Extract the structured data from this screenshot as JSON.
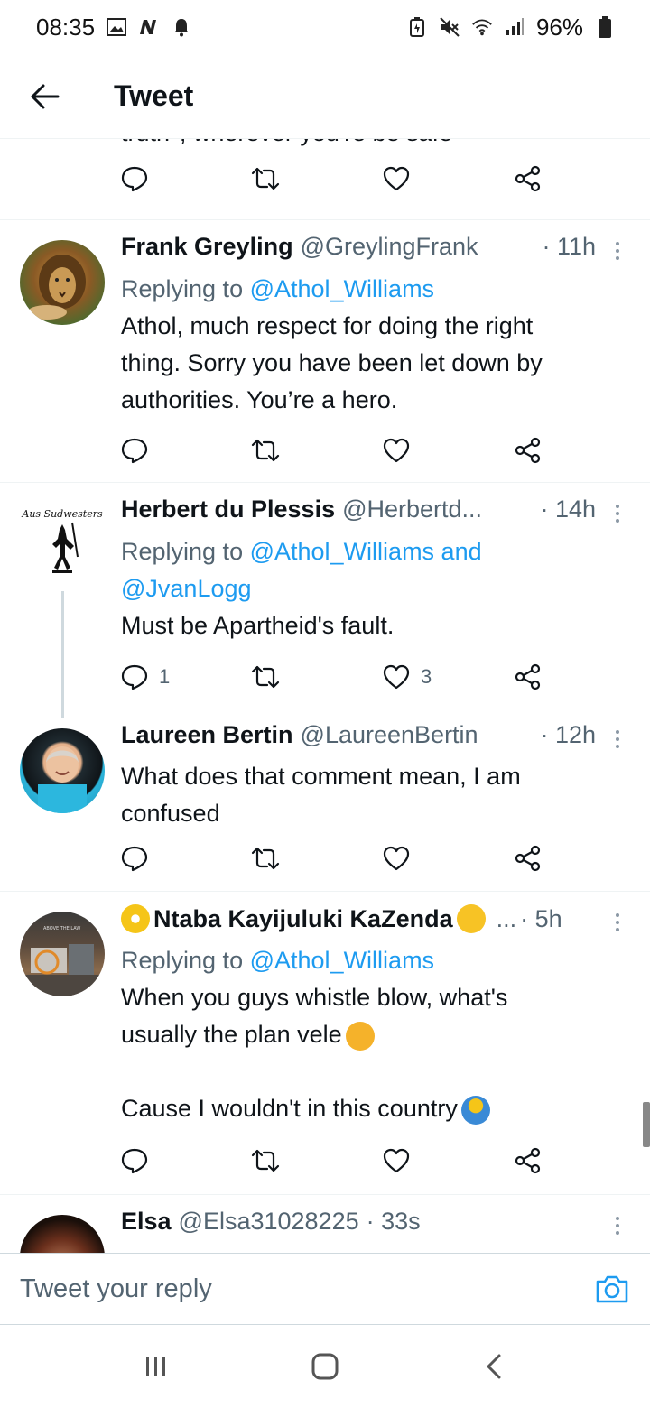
{
  "status_bar": {
    "time": "08:35",
    "battery": "96%"
  },
  "header": {
    "title": "Tweet"
  },
  "partial_tweet": {
    "text": "truth  , wherever you're be safe"
  },
  "tweets": [
    {
      "name": "Frank Greyling",
      "handle": "@GreylingFrank",
      "time": "· 11h",
      "reply_prefix": "Replying to",
      "reply_mentions": "@Athol_Williams",
      "body_lines": [
        "Athol, much respect for doing the right",
        "thing. Sorry you have been let down by",
        "authorities. You’re a hero."
      ],
      "reply_count": "",
      "retweet_count": "",
      "like_count": ""
    },
    {
      "name": "Herbert du Plessis",
      "handle": "@Herbertd...",
      "time": "· 14h",
      "reply_prefix": "Replying to",
      "reply_mentions": "@Athol_Williams and",
      "reply_mentions_2": "@JvanLogg",
      "body_lines": [
        "Must be Apartheid's fault."
      ],
      "reply_count": "1",
      "retweet_count": "",
      "like_count": "3"
    },
    {
      "name": "Laureen Bertin",
      "handle": "@LaureenBertin",
      "time": "· 12h",
      "body_lines": [
        "What does that comment mean, I am",
        "confused"
      ],
      "reply_count": "",
      "retweet_count": "",
      "like_count": ""
    },
    {
      "name": "Ntaba Kayijuluki KaZenda",
      "handle": "...",
      "time": "· 5h",
      "reply_prefix": "Replying to",
      "reply_mentions": "@Athol_Williams",
      "body_line_1": "When you guys whistle blow, what's",
      "body_line_2": "usually the plan vele",
      "body_line_3": "Cause I wouldn't in this country",
      "reply_count": "",
      "retweet_count": "",
      "like_count": ""
    },
    {
      "name": "Elsa",
      "handle": "@Elsa31028225",
      "time": "· 33s"
    }
  ],
  "avatar_texts": {
    "herbert_logo": "Aus Sudwesters",
    "ntaba_caption": "ABOVE THE LAW"
  },
  "reply_bar": {
    "placeholder": "Tweet your reply"
  },
  "icons": {
    "back": "arrow-left-icon",
    "reply": "comment-icon",
    "retweet": "retweet-icon",
    "like": "heart-icon",
    "share": "share-icon",
    "more": "more-vertical-icon",
    "camera": "camera-icon"
  },
  "colors": {
    "link": "#1d9bf0",
    "secondary_text": "#536471",
    "primary_text": "#0f1419"
  }
}
